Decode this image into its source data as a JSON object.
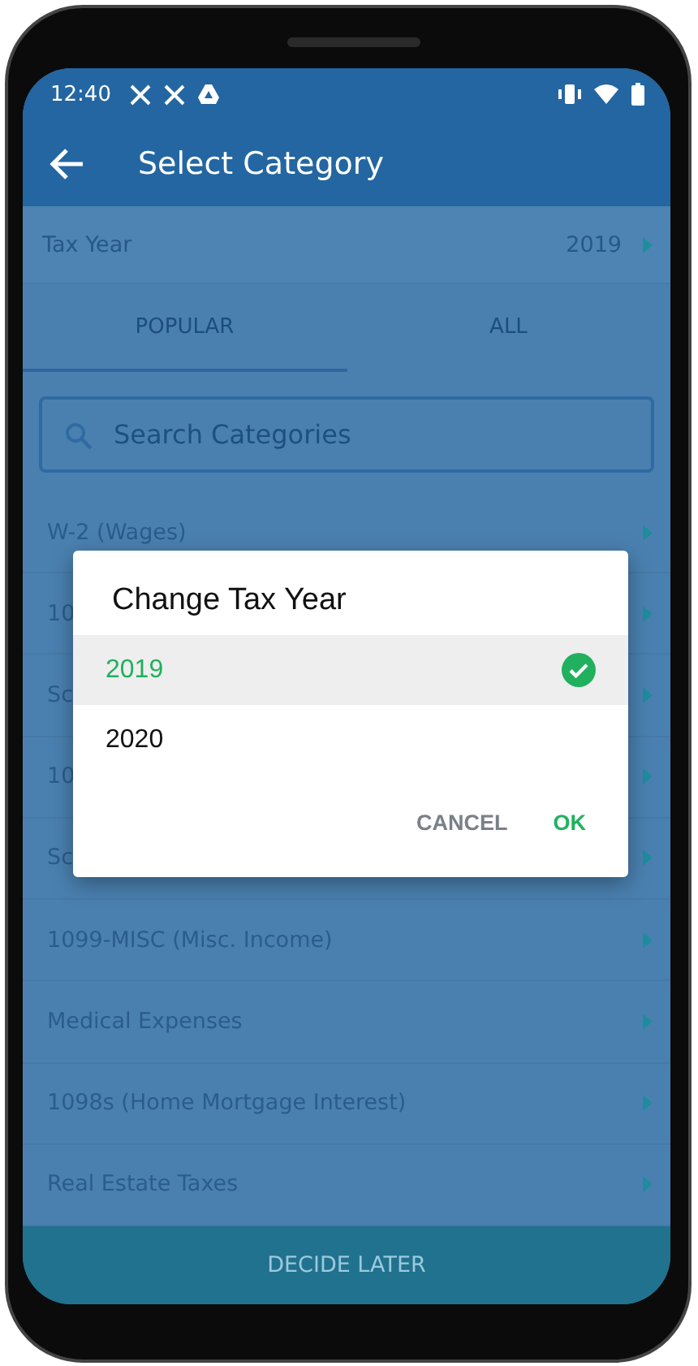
{
  "status_bar": {
    "time": "12:40"
  },
  "app_bar": {
    "title": "Select Category"
  },
  "tax_year": {
    "label": "Tax Year",
    "value": "2019"
  },
  "tabs": [
    {
      "label": "POPULAR",
      "selected": true
    },
    {
      "label": "ALL",
      "selected": false
    }
  ],
  "search": {
    "placeholder": "Search Categories"
  },
  "categories": [
    {
      "label": "W-2 (Wages)"
    },
    {
      "label": "10"
    },
    {
      "label": "Sc"
    },
    {
      "label": "10"
    },
    {
      "label": "Sc"
    },
    {
      "label": "1099-MISC (Misc. Income)"
    },
    {
      "label": "Medical Expenses"
    },
    {
      "label": "1098s (Home Mortgage Interest)"
    },
    {
      "label": "Real Estate Taxes"
    }
  ],
  "footer_button": "DECIDE LATER",
  "dialog": {
    "title": "Change Tax Year",
    "options": [
      {
        "label": "2019",
        "selected": true
      },
      {
        "label": "2020",
        "selected": false
      }
    ],
    "buttons": [
      {
        "label": "CANCEL",
        "kind": "cancel"
      },
      {
        "label": "OK",
        "kind": "confirm"
      }
    ]
  }
}
